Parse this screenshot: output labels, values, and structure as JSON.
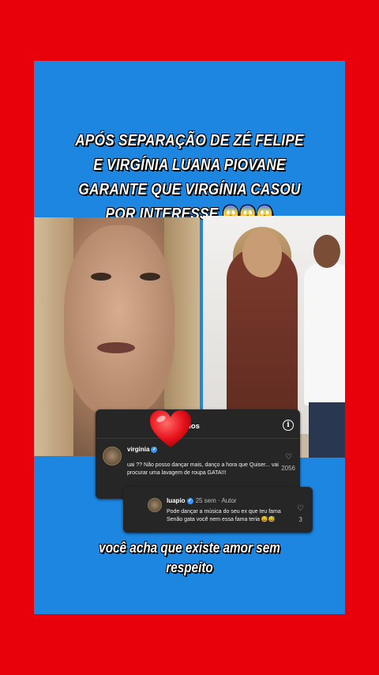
{
  "headline": {
    "line1": "APÓS SEPARAÇÃO DE ZÉ FELIPE",
    "line2": "E VIRGÍNIA LUANA PIOVANE",
    "line3": "GARANTE QUE VIRGÍNIA CASOU",
    "line4": "POR INTERESSE",
    "emoji": "😱😱😱"
  },
  "comments_panel": {
    "title": "entários",
    "info_icon": "info-icon"
  },
  "comment1": {
    "username": "virginia",
    "verified": "✓",
    "text": "uai ?? Não posso dançar mais, danço a hora que Quiser... vai procurar uma lavagem de roupa GATA!!!",
    "likes": "2056"
  },
  "comment2": {
    "username": "luapio",
    "verified": "✓",
    "meta": "25 sem · Autor",
    "text": "Pode dançar a música do seu ex que teu fama Senão gata você nem essa fama teria 😅😅",
    "likes": "3"
  },
  "caption": {
    "line1": "você acha que existe amor sem",
    "line2": "respeito"
  },
  "colors": {
    "background": "#e8000b",
    "frame": "#1c86e0",
    "card": "#262626",
    "heart": "#e8121b"
  }
}
